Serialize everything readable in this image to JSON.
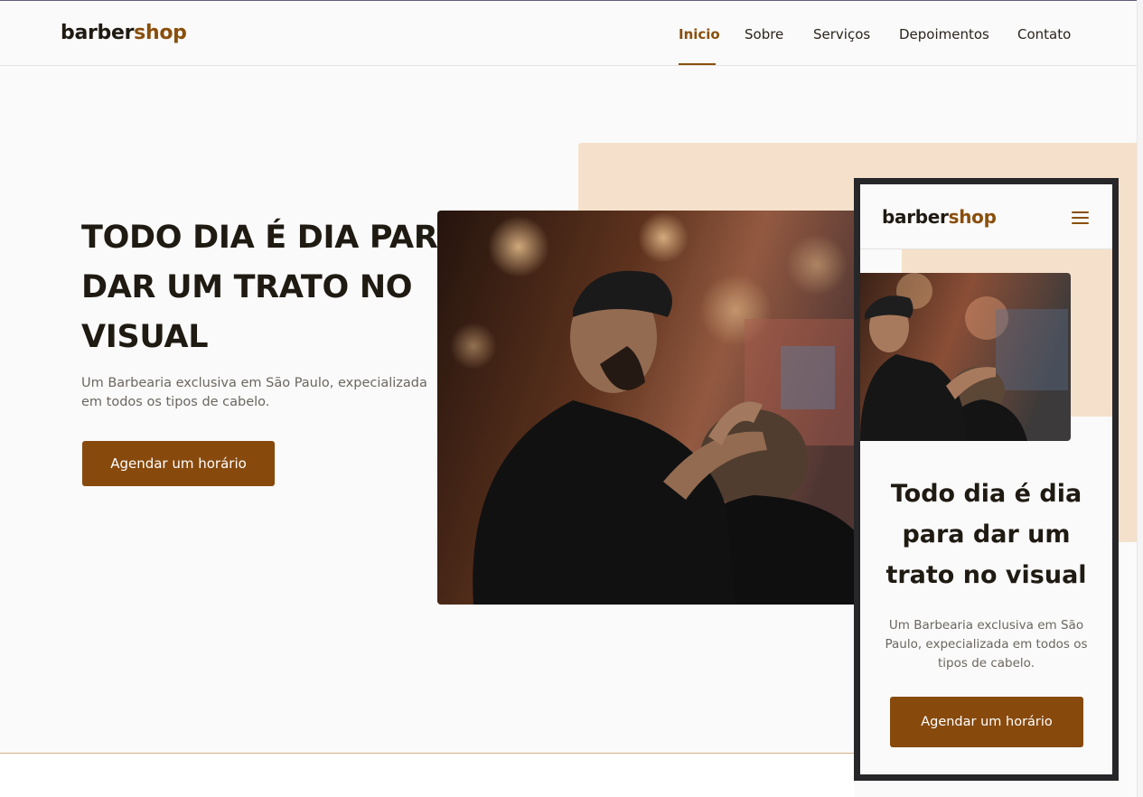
{
  "brand": {
    "part1": "barber",
    "part2": "shop"
  },
  "nav": {
    "items": [
      {
        "label": "Inicio",
        "active": true
      },
      {
        "label": "Sobre",
        "active": false
      },
      {
        "label": "Serviços",
        "active": false
      },
      {
        "label": "Depoimentos",
        "active": false
      },
      {
        "label": "Contato",
        "active": false
      }
    ]
  },
  "hero": {
    "title_lines": [
      "TODO DIA É DIA PARA",
      "DAR UM TRATO NO",
      "VISUAL"
    ],
    "text": "Um Barbearia exclusiva em São Paulo, expecializada em todos os tipos de cabelo.",
    "button": "Agendar um horário",
    "image": "barber-cutting-hair-photo"
  },
  "mobile": {
    "title_lines": [
      "Todo dia é dia",
      "para dar um",
      "trato no visual"
    ],
    "text": "Um Barbearia exclusiva em São Paulo, expecializada em todos os tipos de cabelo.",
    "button": "Agendar um horário",
    "menu_icon": "hamburger-menu-icon"
  },
  "colors": {
    "accent": "#8a4f0c",
    "button": "#87490c",
    "peach": "#f5e1cb",
    "text_dark": "#1f1a12",
    "text_muted": "#6b665f",
    "background": "#fafafa",
    "device_frame": "#27272a"
  }
}
